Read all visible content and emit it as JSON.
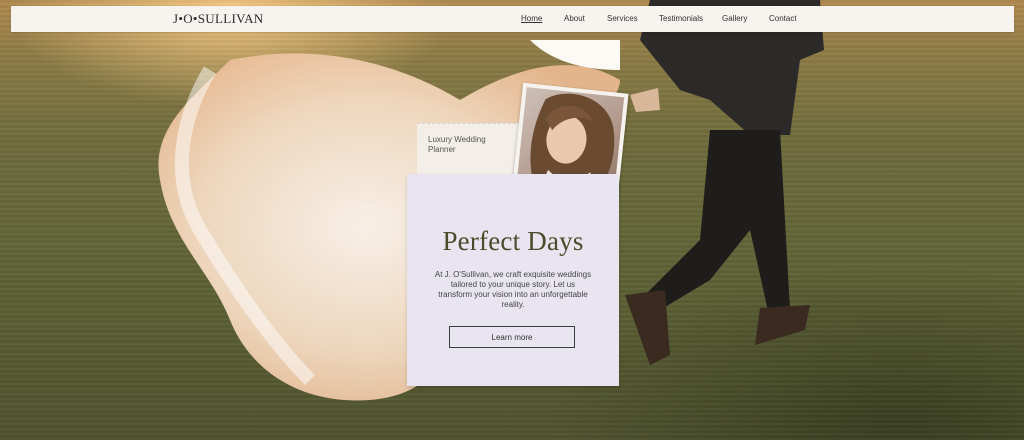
{
  "nav": {
    "logo": "J•O•SULLIVAN",
    "links": [
      "Home",
      "About",
      "Services",
      "Testimonials",
      "Gallery",
      "Contact"
    ],
    "active": "Home"
  },
  "hero": {
    "tag": "Luxury Wedding Planner",
    "title": "Perfect Days",
    "body": "At J. O'Sullivan, we craft exquisite weddings tailored to your unique story. Let us transform your vision into an unforgettable reality.",
    "cta_label": "Learn more"
  },
  "colors": {
    "nav_bg": "#f7f3ef",
    "card_bg": "#e9e5f0",
    "title": "#4b4a2a"
  }
}
